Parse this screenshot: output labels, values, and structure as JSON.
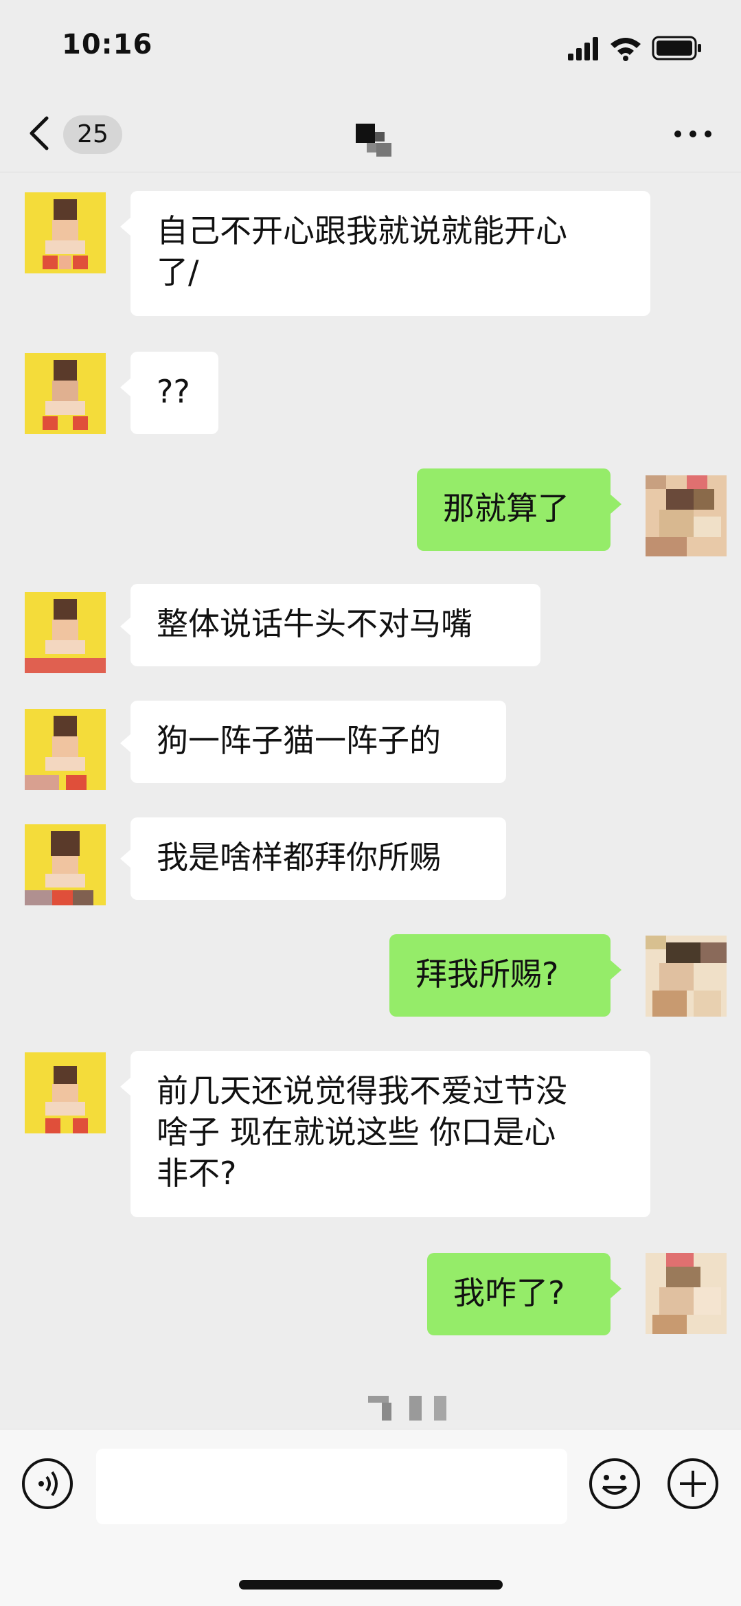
{
  "status_bar": {
    "time": "10:16"
  },
  "nav": {
    "unread_count": "25"
  },
  "messages": [
    {
      "side": "in",
      "text": "自己不开心跟我就说就能开心\n了/"
    },
    {
      "side": "in",
      "text": "??"
    },
    {
      "side": "out",
      "text": "那就算了"
    },
    {
      "side": "in",
      "text": "整体说话牛头不对马嘴"
    },
    {
      "side": "in",
      "text": "狗一阵子猫一阵子的"
    },
    {
      "side": "in",
      "text": "我是啥样都拜你所赐"
    },
    {
      "side": "out",
      "text": "拜我所赐?"
    },
    {
      "side": "in",
      "text": "前几天还说觉得我不爱过节没\n啥子 现在就说这些 你口是心\n非不?"
    },
    {
      "side": "out",
      "text": "我咋了?"
    }
  ],
  "input": {
    "value": ""
  },
  "colors": {
    "incoming_bubble": "#ffffff",
    "outgoing_bubble": "#95ec69",
    "background": "#ededed"
  },
  "icons": [
    "back-chevron-icon",
    "more-icon",
    "voice-icon",
    "emoji-icon",
    "plus-icon",
    "signal-icon",
    "wifi-icon",
    "battery-icon"
  ]
}
